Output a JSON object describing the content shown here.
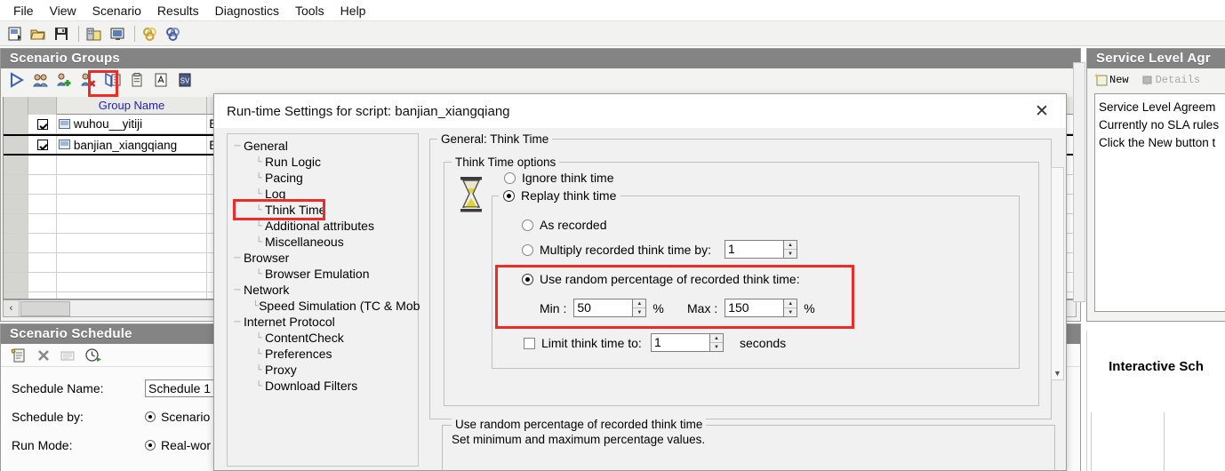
{
  "menu": {
    "items": [
      {
        "label": "File"
      },
      {
        "label": "View"
      },
      {
        "label": "Scenario"
      },
      {
        "label": "Results"
      },
      {
        "label": "Diagnostics"
      },
      {
        "label": "Tools"
      },
      {
        "label": "Help"
      }
    ]
  },
  "main_toolbar": {
    "icons": [
      {
        "name": "new-scenario-icon"
      },
      {
        "name": "open-folder-icon"
      },
      {
        "name": "save-icon"
      },
      {
        "name": "generators-icon"
      },
      {
        "name": "monitor-icon"
      },
      {
        "name": "start-scenario-icon"
      },
      {
        "name": "stop-scenario-icon"
      }
    ]
  },
  "groups_panel": {
    "title": "Scenario Groups",
    "toolbar_icons": [
      {
        "name": "run-group-icon"
      },
      {
        "name": "vusers-icon"
      },
      {
        "name": "add-group-icon"
      },
      {
        "name": "remove-group-icon"
      },
      {
        "name": "runtime-settings-icon"
      },
      {
        "name": "details-icon"
      },
      {
        "name": "view-script-icon"
      },
      {
        "name": "sv-icon"
      }
    ],
    "highlighted_toolbar_index": 4,
    "table": {
      "columns": [
        "",
        "",
        "Group Name",
        ""
      ],
      "rows": [
        {
          "checked": true,
          "group_name": "wuhou__yitiji",
          "path": "E:"
        },
        {
          "checked": true,
          "group_name": "banjian_xiangqiang",
          "path": "E:",
          "selected": true
        }
      ],
      "empty_row_count": 9
    },
    "hscroll": {
      "left_arrow": "‹"
    }
  },
  "schedule_panel": {
    "title": "Scenario Schedule",
    "toolbar_icons": [
      {
        "name": "new-schedule-icon"
      },
      {
        "name": "delete-schedule-icon"
      },
      {
        "name": "rename-schedule-icon"
      },
      {
        "name": "schedule-clock-icon"
      }
    ],
    "fields": [
      {
        "label": "Schedule Name:",
        "value": "Schedule 1",
        "type": "text"
      },
      {
        "label": "Schedule by:",
        "value": "Scenario",
        "type": "radio",
        "selected": true
      },
      {
        "label": "Run Mode:",
        "value": "Real-wor",
        "type": "radio",
        "selected": true
      }
    ]
  },
  "sla_panel": {
    "title": "Service Level Agr",
    "buttons": [
      {
        "label": "New",
        "enabled": true,
        "icon": "new-sla-icon"
      },
      {
        "label": "Details",
        "enabled": false,
        "icon": "details-sla-icon"
      }
    ],
    "body_lines": [
      "Service Level Agreem",
      "Currently no SLA rules",
      "Click the New button t"
    ]
  },
  "interactive_schedule": {
    "title": "Interactive Sch"
  },
  "dialog": {
    "title": "Run-time Settings for script: banjian_xiangqiang",
    "close_label": "✕",
    "tree": {
      "nodes": [
        {
          "label": "General",
          "level": 0
        },
        {
          "label": "Run Logic",
          "level": 1
        },
        {
          "label": "Pacing",
          "level": 1
        },
        {
          "label": "Log",
          "level": 1
        },
        {
          "label": "Think Time",
          "level": 1,
          "highlighted": true
        },
        {
          "label": "Additional attributes",
          "level": 1
        },
        {
          "label": "Miscellaneous",
          "level": 1
        },
        {
          "label": "Browser",
          "level": 0
        },
        {
          "label": "Browser Emulation",
          "level": 1
        },
        {
          "label": "Network",
          "level": 0
        },
        {
          "label": "Speed Simulation (TC & Mob",
          "level": 1
        },
        {
          "label": "Internet Protocol",
          "level": 0
        },
        {
          "label": "ContentCheck",
          "level": 1
        },
        {
          "label": "Preferences",
          "level": 1
        },
        {
          "label": "Proxy",
          "level": 1
        },
        {
          "label": "Download Filters",
          "level": 1
        }
      ]
    },
    "content": {
      "group_legend": "General: Think Time",
      "options_legend": "Think Time options",
      "hourglass_icon": "hourglass-icon",
      "ignore_think_time": {
        "label": "Ignore think time",
        "selected": false
      },
      "replay_think_time": {
        "label": "Replay think time",
        "selected": true
      },
      "as_recorded": {
        "label": "As recorded",
        "selected": false
      },
      "multiply": {
        "label": "Multiply recorded think time by:",
        "selected": false,
        "value": "1"
      },
      "random_percentage": {
        "label": "Use random percentage of recorded think time:",
        "selected": true,
        "highlighted": true,
        "min_label": "Min :",
        "min_value": "50",
        "min_unit": "%",
        "max_label": "Max :",
        "max_value": "150",
        "max_unit": "%"
      },
      "limit": {
        "label": "Limit think time to:",
        "checked": false,
        "value": "1",
        "unit": "seconds"
      },
      "description": {
        "legend": "Use random percentage of recorded think time",
        "text": "Set minimum and maximum percentage values."
      }
    }
  },
  "colors": {
    "panel_title_bg": "#848484",
    "highlight_red": "#ee2b24",
    "header_text_blue": "#2222bb",
    "dialog_bg": "#f1f1f1"
  }
}
